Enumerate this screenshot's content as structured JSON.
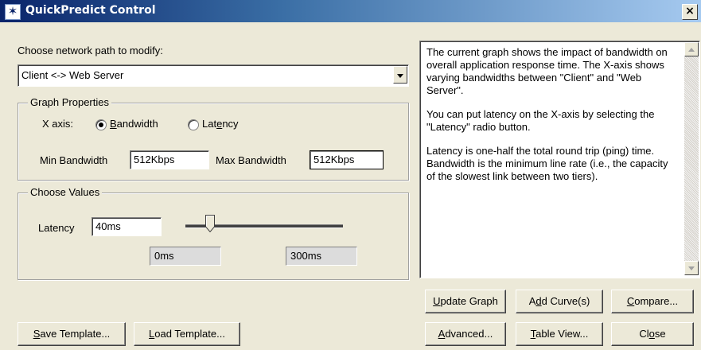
{
  "window": {
    "title": "QuickPredict Control",
    "close_label": "×"
  },
  "path": {
    "label": "Choose network path to modify:",
    "selected": "Client <-> Web Server"
  },
  "graph_properties": {
    "title": "Graph Properties",
    "x_axis_label": "X axis:",
    "options": [
      {
        "mn": "B",
        "rest": "andwidth",
        "checked": true
      },
      {
        "pre": "Lat",
        "mn": "e",
        "rest": "ncy",
        "checked": false
      }
    ],
    "min_label": "Min Bandwidth",
    "min_value": "512Kbps",
    "max_label": "Max Bandwidth",
    "max_value": "512Kbps"
  },
  "choose_values": {
    "title": "Choose Values",
    "latency_label": "Latency",
    "latency_value": "40ms",
    "slider_min": "0ms",
    "slider_max": "300ms",
    "slider_fraction": 0.133
  },
  "help_text": [
    "The current graph shows the impact of bandwidth on overall application response time. The X-axis shows varying bandwidths between \"Client\" and \"Web Server\".",
    "You can put latency on the X-axis by selecting the \"Latency\" radio button.",
    "Latency is one-half the total round trip (ping) time. Bandwidth is the minimum line rate (i.e., the capacity of the slowest link between two tiers)."
  ],
  "buttons": {
    "update_graph": {
      "mn": "U",
      "rest": "pdate Graph"
    },
    "add_curves": {
      "pre": "A",
      "mn": "d",
      "rest": "d Curve(s)"
    },
    "compare": {
      "mn": "C",
      "rest": "ompare..."
    },
    "save_template": {
      "mn": "S",
      "rest": "ave Template..."
    },
    "load_template": {
      "mn": "L",
      "rest": "oad Template..."
    },
    "advanced": {
      "mn": "A",
      "rest": "dvanced..."
    },
    "table_view": {
      "mn": "T",
      "rest": "able View..."
    },
    "close": {
      "pre": "Cl",
      "mn": "o",
      "rest": "se"
    }
  }
}
